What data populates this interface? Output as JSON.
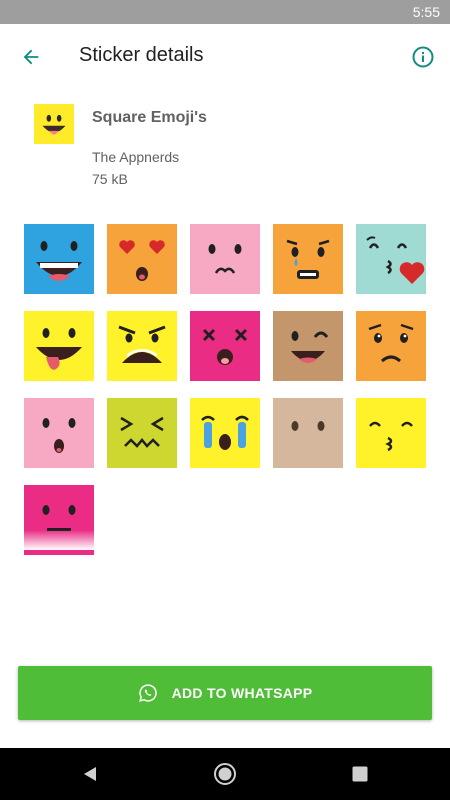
{
  "status_bar": {
    "time": "5:55"
  },
  "app_bar": {
    "title": "Sticker details",
    "back_icon": "arrow-back-icon",
    "info_icon": "info-icon"
  },
  "pack": {
    "name": "Square Emoji's",
    "publisher": "The Appnerds",
    "size": "75 kB"
  },
  "stickers": [
    {
      "name": "sticker-grinning",
      "color": "#2ea3df"
    },
    {
      "name": "sticker-heart-eyes",
      "color": "#f7a33c"
    },
    {
      "name": "sticker-confused",
      "color": "#f7a8c3"
    },
    {
      "name": "sticker-anxious-sweat",
      "color": "#f7a33c"
    },
    {
      "name": "sticker-kiss-heart",
      "color": "#9fdbd3"
    },
    {
      "name": "sticker-tongue-out",
      "color": "#fff12a"
    },
    {
      "name": "sticker-angry-grimace",
      "color": "#fff12a"
    },
    {
      "name": "sticker-dizzy",
      "color": "#ea2c84"
    },
    {
      "name": "sticker-winking",
      "color": "#c4966b"
    },
    {
      "name": "sticker-worried",
      "color": "#f7a33c"
    },
    {
      "name": "sticker-surprised",
      "color": "#f7a8c3"
    },
    {
      "name": "sticker-confounded",
      "color": "#cdd72f"
    },
    {
      "name": "sticker-crying",
      "color": "#fff12a"
    },
    {
      "name": "sticker-no-mouth",
      "color": "#d4b79c"
    },
    {
      "name": "sticker-kissing",
      "color": "#fff12a"
    },
    {
      "name": "sticker-neutral",
      "color": "#ea2c84"
    }
  ],
  "add_button": {
    "label": "ADD TO WHATSAPP",
    "icon": "whatsapp-icon",
    "color": "#4fbd37"
  },
  "nav_bar": {
    "back": "nav-back-icon",
    "home": "nav-home-icon",
    "recents": "nav-recents-icon"
  },
  "colors": {
    "accent": "#128c7e",
    "primary_text": "#212121",
    "secondary_text": "#616161"
  }
}
